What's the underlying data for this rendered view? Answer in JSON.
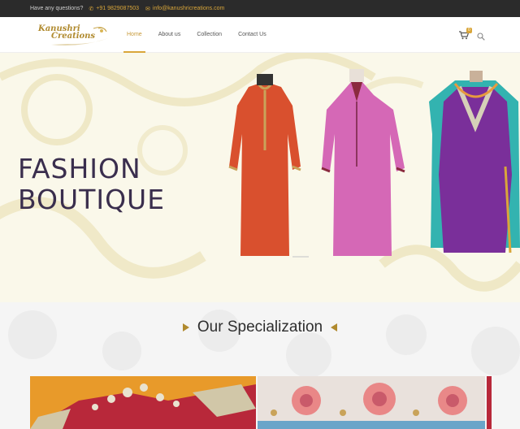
{
  "topbar": {
    "question": "Have any questions?",
    "phone": "+91 9829087503",
    "email": "info@kanushricreations.com",
    "phone_icon": "phone-icon",
    "email_icon": "envelope-icon"
  },
  "logo": {
    "line1": "Kanushri",
    "line2": "Creations"
  },
  "nav": {
    "items": [
      {
        "label": "Home"
      },
      {
        "label": "About us"
      },
      {
        "label": "Collection"
      },
      {
        "label": "Contact Us"
      }
    ],
    "active": "Home"
  },
  "cart": {
    "count": "0",
    "icon": "cart-icon"
  },
  "search": {
    "icon": "search-icon"
  },
  "hero": {
    "line1": "FASHION",
    "line2": "BOUTIQUE"
  },
  "specialization": {
    "title": "Our Specialization"
  },
  "colors": {
    "accent": "#d9a63a",
    "topbar_bg": "#2b2b2b",
    "hero_bg": "#faf8ea",
    "headline": "#3a2e4d"
  }
}
